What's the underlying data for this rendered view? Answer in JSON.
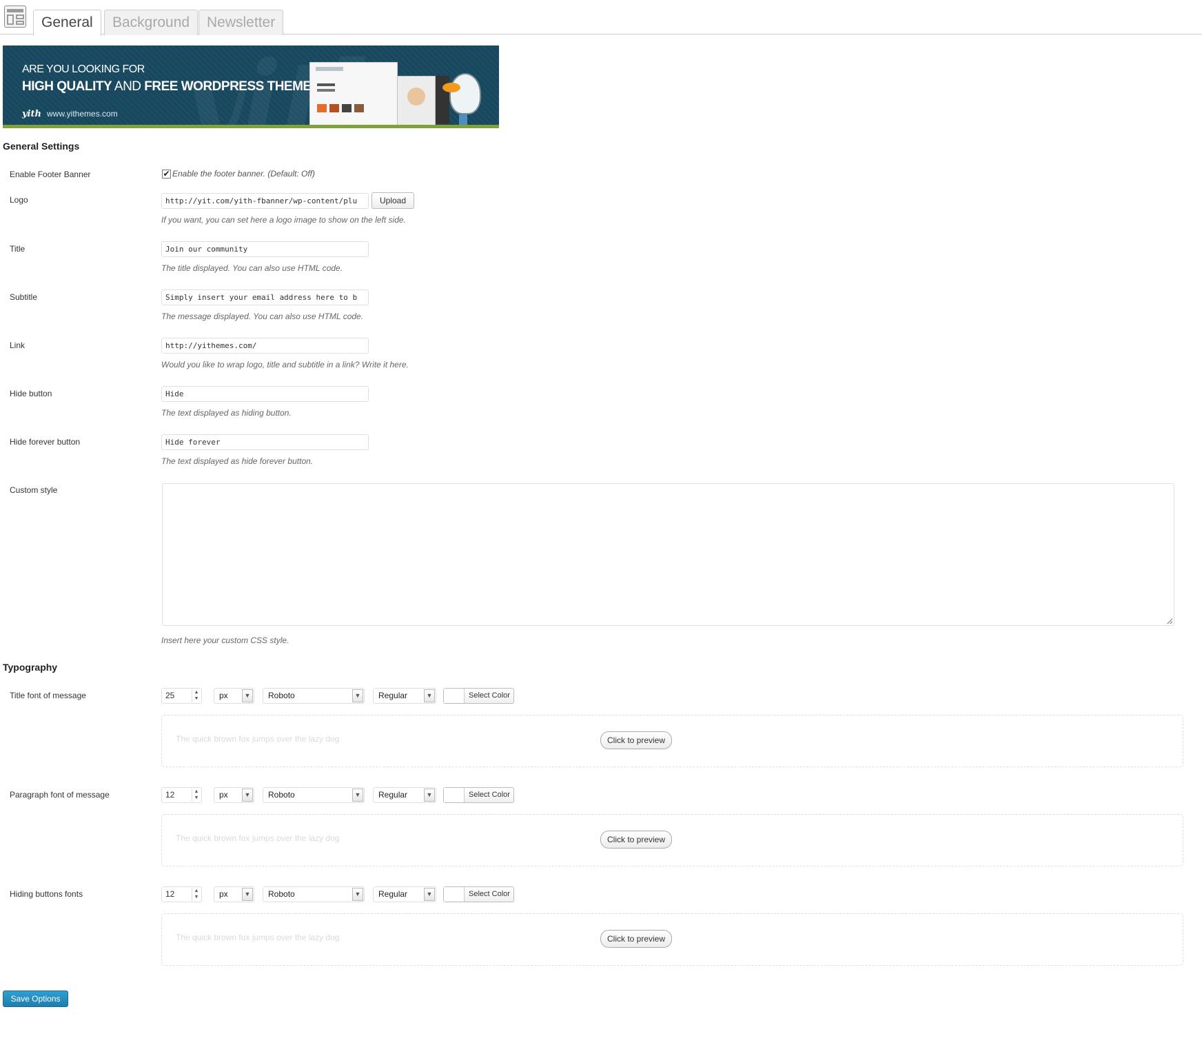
{
  "tabs": [
    {
      "label": "General",
      "active": true
    },
    {
      "label": "Background",
      "active": false
    },
    {
      "label": "Newsletter",
      "active": false
    }
  ],
  "banner": {
    "line1": "ARE YOU LOOKING FOR",
    "line2_a": "HIGH QUALITY",
    "line2_b": " AND ",
    "line2_c": "FREE WORDPRESS THEMES?",
    "brand": "yith",
    "url": "www.yithemes.com"
  },
  "general": {
    "title": "General Settings",
    "enable_banner": {
      "label": "Enable Footer Banner",
      "checked": true,
      "text": "Enable the footer banner. (Default: Off)"
    },
    "logo": {
      "label": "Logo",
      "value": "http://yit.com/yith-fbanner/wp-content/plu",
      "button": "Upload",
      "hint": "If you want, you can set here a logo image to show on the left side."
    },
    "title_field": {
      "label": "Title",
      "value": "Join our community",
      "hint": "The title displayed. You can also use HTML code."
    },
    "subtitle": {
      "label": "Subtitle",
      "value": "Simply insert your email address here to b",
      "hint": "The message displayed. You can also use HTML code."
    },
    "link": {
      "label": "Link",
      "value": "http://yithemes.com/",
      "hint": "Would you like to wrap logo, title and subtitle in a link? Write it here."
    },
    "hide_button": {
      "label": "Hide button",
      "value": "Hide",
      "hint": "The text displayed as hiding button."
    },
    "hide_forever": {
      "label": "Hide forever button",
      "value": "Hide forever",
      "hint": "The text displayed as hide forever button."
    },
    "custom_style": {
      "label": "Custom style",
      "value": "",
      "hint": "Insert here your custom CSS style."
    }
  },
  "typography": {
    "title": "Typography",
    "rows": [
      {
        "label": "Title font of message",
        "size": "25",
        "unit": "px",
        "family": "Roboto",
        "weight": "Regular",
        "color_button": "Select Color",
        "preview_text": "The quick brown fox jumps over the lazy dog",
        "preview_button": "Click to preview"
      },
      {
        "label": "Paragraph font of message",
        "size": "12",
        "unit": "px",
        "family": "Roboto",
        "weight": "Regular",
        "color_button": "Select Color",
        "preview_text": "The quick brown fox jumps over the lazy dog",
        "preview_button": "Click to preview"
      },
      {
        "label": "Hiding buttons fonts",
        "size": "12",
        "unit": "px",
        "family": "Roboto",
        "weight": "Regular",
        "color_button": "Select Color",
        "preview_text": "The quick brown fox jumps over the lazy dog",
        "preview_button": "Click to preview"
      }
    ]
  },
  "save_button": "Save Options",
  "colors": {
    "primary_button": "#2189bc",
    "banner_bg": "#18485f"
  }
}
